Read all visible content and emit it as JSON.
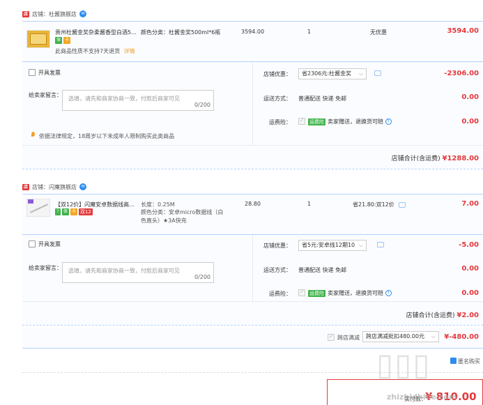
{
  "shop1": {
    "label": "店铺：杜酱旗舰店",
    "item": {
      "title": "贵州杜酱金奖杂柔酱香型白酒5...",
      "sku": "颜色分类：杜酱金奖500ml*6瓶",
      "unit_price": "3594.00",
      "qty": "1",
      "discount": "无优惠",
      "subtotal": "3594.00",
      "notice": "此商品性质不支持7天退货",
      "notice_link": "详情"
    },
    "invoice": "开具发票",
    "memo_label": "给卖家留言：",
    "memo_placeholder": "选填，请先和商家协商一致，付款后商家可见",
    "memo_count": "0/200",
    "legal_notice": "依据法律规定，18周岁以下未成年人限制购买此类商品",
    "coupon_label": "店铺优惠：",
    "coupon_value": "省2306元:杜酱金奖",
    "coupon_amount": "-2306.00",
    "ship_label": "运送方式：",
    "ship_value": "普通配送 快递 免邮",
    "ship_amount": "0.00",
    "ins_label": "运费险：",
    "ins_badge": "运费险",
    "ins_text": "卖家赠送，退换货可赔",
    "ins_amount": "0.00",
    "total_label": "店铺合计(含运费)",
    "total_value": "¥1288.00"
  },
  "shop2": {
    "label": "店铺：闪魔旗舰店",
    "item": {
      "title": "【双12价】闪魔安卓数据线高...",
      "badge": "双12",
      "spec_len": "长度：0.25M",
      "sku": "颜色分类：安卓micro数据线（白色直头）★3A快充",
      "unit_price": "28.80",
      "qty": "1",
      "discount": "省21.80:双12价",
      "subtotal": "7.00"
    },
    "invoice": "开具发票",
    "memo_label": "给卖家留言：",
    "memo_placeholder": "选填，请先和商家协商一致，付款后商家可见",
    "memo_count": "0/200",
    "coupon_label": "店铺优惠：",
    "coupon_value": "省5元:安卓线12期10",
    "coupon_amount": "-5.00",
    "ship_label": "运送方式：",
    "ship_value": "普通配送 快递 免邮",
    "ship_amount": "0.00",
    "ins_label": "运费险：",
    "ins_badge": "运费险",
    "ins_text": "卖家赠送，退换货可赔",
    "ins_amount": "0.00",
    "total_label": "店铺合计(含运费)",
    "total_value": "¥2.00"
  },
  "cross_shop": {
    "label": "跨店满减",
    "select": "跨店满减批扣480.00元",
    "amount": "¥-480.00"
  },
  "footer": {
    "anon_partial": "匿名购买",
    "pay_partial": "实付款：",
    "pay_value": "¥ 810.00",
    "watermark": "值 什么值得买",
    "watermark_url": "zhizhidhide.com"
  },
  "colors": {
    "price": "#e4393c",
    "border": "#b2d1ff",
    "green": "#3fb24a",
    "blue": "#2d8cf0"
  }
}
